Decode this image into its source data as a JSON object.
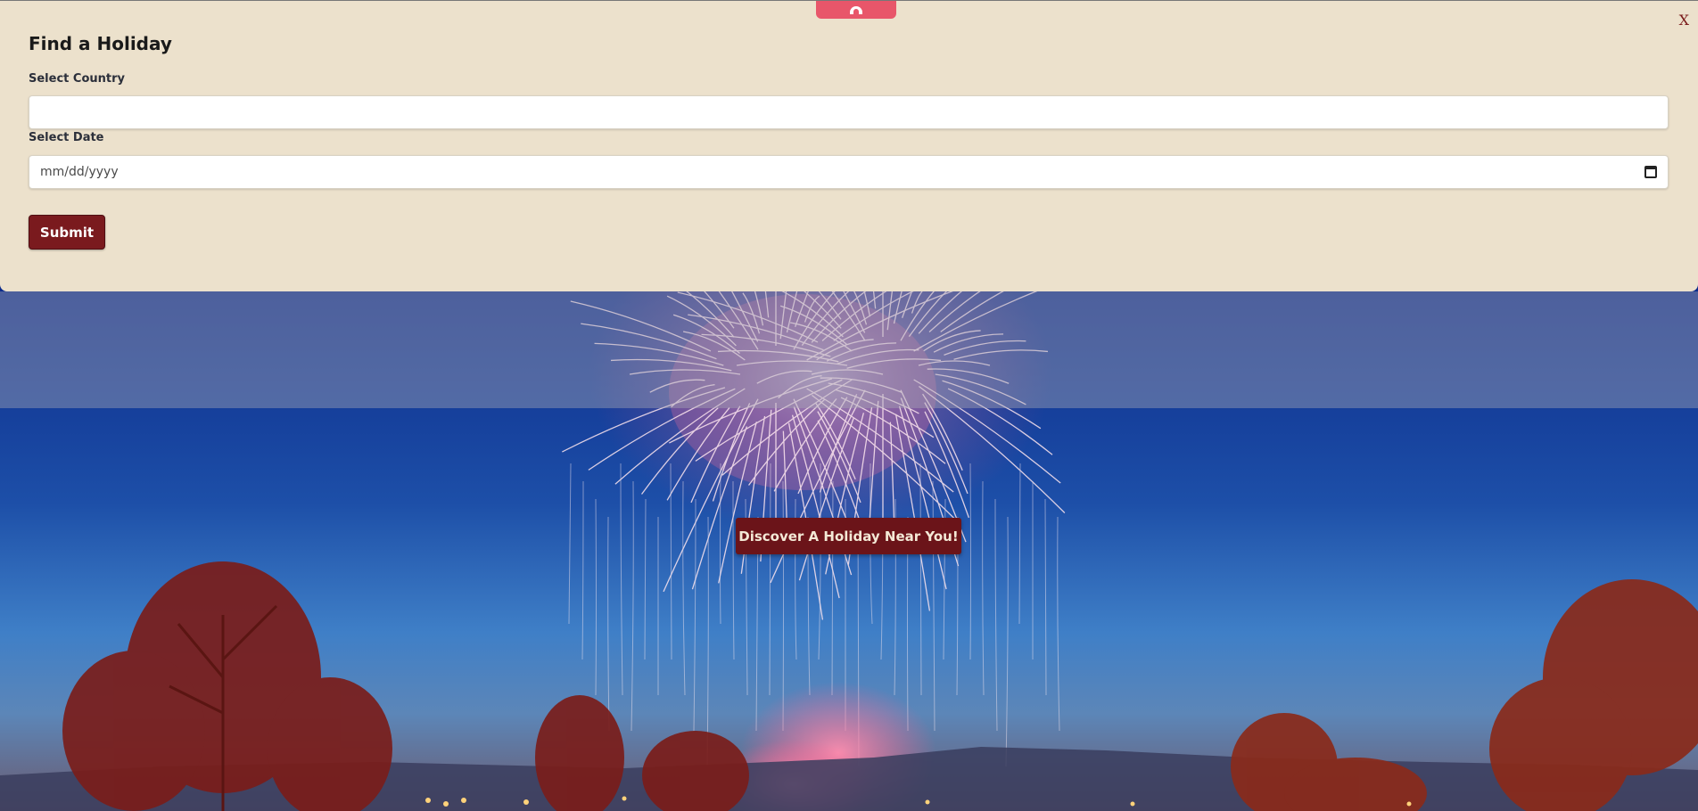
{
  "panel": {
    "title": "Find a Holiday",
    "close_label": "X",
    "country_label": "Select Country",
    "country_value": "",
    "date_label": "Select Date",
    "date_placeholder": "mm/dd/yyyy",
    "submit_label": "Submit"
  },
  "hero": {
    "cta_label": "Discover A Holiday Near You!"
  },
  "icons": {
    "pull_tab": "chevron-up-icon",
    "date_picker": "calendar-icon"
  },
  "colors": {
    "panel_bg": "#ece1cc",
    "accent_maroon": "#7a1a1e",
    "pull_tab": "#e8566a",
    "cta_bg": "#6b1419"
  }
}
